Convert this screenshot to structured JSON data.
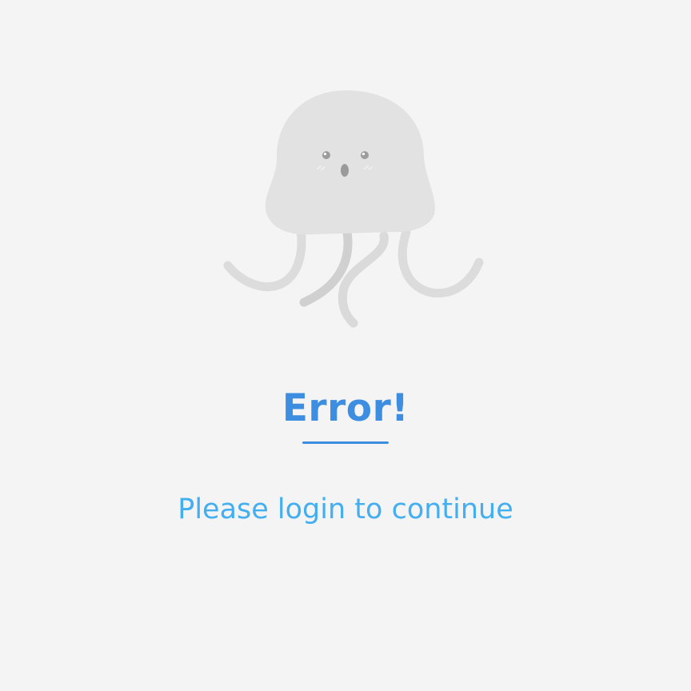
{
  "error": {
    "title": "Error!",
    "message": "Please login to continue"
  },
  "illustration": {
    "name": "jellyfish-icon"
  },
  "colors": {
    "background": "#f4f4f4",
    "title": "#3d8ee0",
    "message": "#43aef0",
    "jelly_body": "#e2e2e2",
    "jelly_tentacle": "#dadada"
  }
}
